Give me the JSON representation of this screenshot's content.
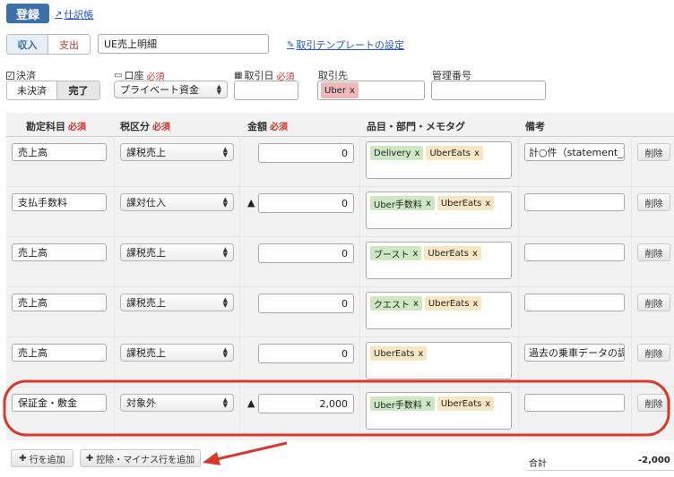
{
  "header": {
    "register_label": "登録",
    "journal_link": "仕訳帳"
  },
  "type_toggle": {
    "income": "収入",
    "expense": "支出"
  },
  "title_input": {
    "value": "UE売上明細"
  },
  "template_link": "取引テンプレートの設定",
  "settlement": {
    "label": "決済",
    "unsettled": "未決済",
    "done": "完了"
  },
  "account": {
    "label": "口座",
    "required": "必須",
    "value": "プライベート資金"
  },
  "txn_date": {
    "label": "取引日",
    "required": "必須",
    "value": ""
  },
  "partner": {
    "label": "取引先",
    "tag": "Uber",
    "tag_x": "x"
  },
  "mgmt_no": {
    "label": "管理番号",
    "value": ""
  },
  "table": {
    "headers": {
      "account_item": "勘定科目",
      "tax": "税区分",
      "amount": "金額",
      "tags": "品目・部門・メモタグ",
      "note": "備考",
      "required": "必須"
    },
    "rows": [
      {
        "account": "売上高",
        "tax": "課税売上",
        "prefix": "",
        "amount": "0",
        "tags": [
          {
            "text": "Delivery",
            "color": "green"
          },
          {
            "text": "UberEats",
            "color": "yellow"
          }
        ],
        "note": "計○件（statement_）",
        "delete": "削除"
      },
      {
        "account": "支払手数料",
        "tax": "課対仕入",
        "prefix": "▲",
        "amount": "0",
        "tags": [
          {
            "text": "Uber手数料",
            "color": "green"
          },
          {
            "text": "UberEats",
            "color": "yellow"
          }
        ],
        "note": "",
        "delete": "削除"
      },
      {
        "account": "売上高",
        "tax": "課税売上",
        "prefix": "",
        "amount": "0",
        "tags": [
          {
            "text": "ブースト",
            "color": "green"
          },
          {
            "text": "UberEats",
            "color": "yellow"
          }
        ],
        "note": "",
        "delete": "削除"
      },
      {
        "account": "売上高",
        "tax": "課税売上",
        "prefix": "",
        "amount": "0",
        "tags": [
          {
            "text": "クエスト",
            "color": "green"
          },
          {
            "text": "UberEats",
            "color": "yellow"
          }
        ],
        "note": "",
        "delete": "削除"
      },
      {
        "account": "売上高",
        "tax": "課税売上",
        "prefix": "",
        "amount": "0",
        "tags": [
          {
            "text": "UberEats",
            "color": "yellow"
          }
        ],
        "note": "過去の乗車データの調整",
        "delete": "削除"
      },
      {
        "account": "保証金・敷金",
        "tax": "対象外",
        "prefix": "▲",
        "amount": "2,000",
        "tags": [
          {
            "text": "Uber手数料",
            "color": "green"
          },
          {
            "text": "UberEats",
            "color": "yellow"
          }
        ],
        "note": "",
        "delete": "削除"
      }
    ]
  },
  "footer": {
    "add_row": "行を追加",
    "add_minus_row": "控除・マイナス行を追加",
    "total_label": "合計",
    "total_value": "-2,000"
  },
  "colors": {
    "primary": "#3d6fa8",
    "required": "#d0342c",
    "highlight": "#d9382a",
    "link": "#2255cc",
    "tag_green": "#cfe8c4",
    "tag_yellow": "#f7e6c4",
    "partner_tag": "#efb9b9"
  }
}
